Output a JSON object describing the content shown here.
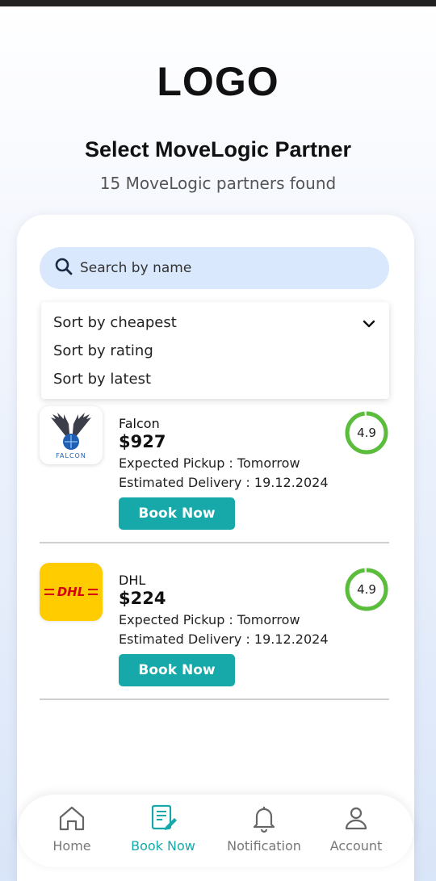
{
  "header": {
    "logo": "LOGO",
    "title": "Select MoveLogic Partner",
    "subtitle": "15 MoveLogic partners found"
  },
  "search": {
    "placeholder": "Search by name"
  },
  "sort": {
    "options": [
      "Sort by cheapest",
      "Sort by rating",
      "Sort by latest"
    ],
    "selected": "Sort by cheapest"
  },
  "partners": [
    {
      "name": "Falcon",
      "price": "$927",
      "pickup": "Expected Pickup : Tomorrow",
      "delivery": "Estimated Delivery : 19.12.2024",
      "rating": "4.9",
      "book_label": "Book Now",
      "logo_icon": "falcon-logo",
      "logo_text": "FALCON"
    },
    {
      "name": "DHL",
      "price": "$224",
      "pickup": "Expected Pickup : Tomorrow",
      "delivery": "Estimated Delivery : 19.12.2024",
      "rating": "4.9",
      "book_label": "Book Now",
      "logo_icon": "dhl-logo",
      "logo_text": "DHL"
    }
  ],
  "nav": {
    "items": [
      {
        "label": "Home",
        "icon": "home-icon"
      },
      {
        "label": "Book Now",
        "icon": "book-now-icon",
        "active": true
      },
      {
        "label": "Notification",
        "icon": "bell-icon"
      },
      {
        "label": "Account",
        "icon": "user-icon"
      }
    ]
  },
  "colors": {
    "accent": "#17a9a9",
    "search_bg": "#d9e8fc",
    "rating_ring": "#5bbd3c",
    "dhl_yellow": "#ffcc00",
    "dhl_red": "#d40511"
  }
}
